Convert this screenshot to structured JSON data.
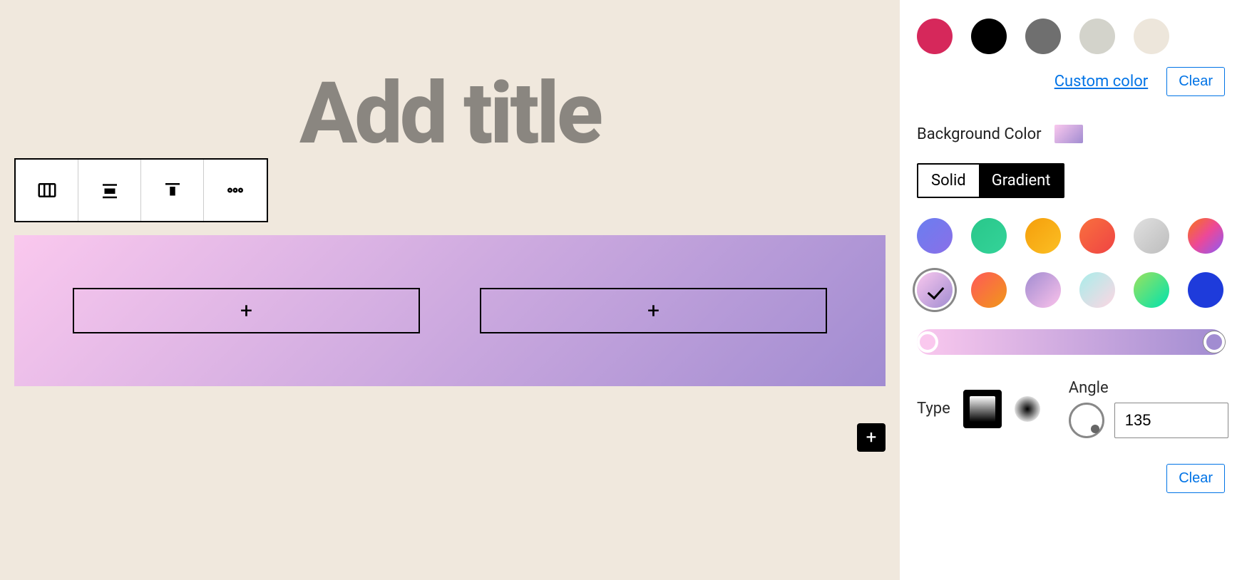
{
  "editor": {
    "title_placeholder": "Add title",
    "toolbar": {
      "columns_icon": "columns-icon",
      "align_icon": "align-icon",
      "valign_icon": "valign-top-icon",
      "more_icon": "more-icon"
    },
    "column_add_label": "+",
    "fab_label": "+"
  },
  "sidebar": {
    "text_color": {
      "swatches": [
        "#d6285b",
        "#000000",
        "#6f6f6f",
        "#d3d3cb",
        "#ede6db"
      ],
      "custom_color_label": "Custom color",
      "clear_label": "Clear"
    },
    "background": {
      "label": "Background Color",
      "segments": {
        "solid": "Solid",
        "gradient": "Gradient",
        "active": "gradient"
      },
      "gradients": [
        {
          "css": "linear-gradient(135deg,#6a7ef0,#8a6fe8)",
          "selected": false
        },
        {
          "css": "linear-gradient(135deg,#29c78a,#34d399)",
          "selected": false
        },
        {
          "css": "linear-gradient(135deg,#f59e0b,#fbbf24)",
          "selected": false
        },
        {
          "css": "linear-gradient(135deg,#f9703e,#ef4444)",
          "selected": false
        },
        {
          "css": "linear-gradient(135deg,#e0e0e0,#bdbdbd)",
          "selected": false
        },
        {
          "css": "linear-gradient(135deg,#f97316,#ec4899,#8b5cf6)",
          "selected": false
        },
        {
          "css": "linear-gradient(135deg,#fac8ee 0%,#a18cd1 100%)",
          "selected": true
        },
        {
          "css": "linear-gradient(135deg,#ff5858,#f09819)",
          "selected": false
        },
        {
          "css": "linear-gradient(135deg,#a18cd1,#fbc2eb)",
          "selected": false
        },
        {
          "css": "linear-gradient(135deg,#a8edea,#fed6e3)",
          "selected": false
        },
        {
          "css": "linear-gradient(135deg,#9be15d,#00e3ae)",
          "selected": false
        },
        {
          "css": "linear-gradient(135deg,#1e3bdb,#1e3bdb)",
          "selected": false
        }
      ],
      "stops": {
        "start": "#fac8ee",
        "end": "#a18cd1"
      },
      "type_label": "Type",
      "type_selected": "linear",
      "angle_label": "Angle",
      "angle_value": "135",
      "clear_label": "Clear"
    }
  }
}
